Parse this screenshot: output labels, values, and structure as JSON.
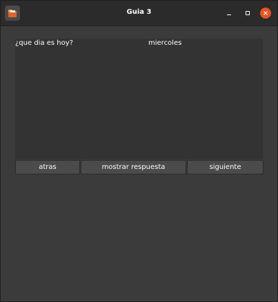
{
  "window": {
    "title": "Guia 3"
  },
  "titlebar": {
    "app_icon": "app-folder-icon",
    "controls": [
      "minimize-icon",
      "maximize-icon",
      "close-icon"
    ],
    "close_color": "#e95420"
  },
  "card": {
    "question": "¿que dia es hoy?",
    "answer": "miercoles"
  },
  "buttons": {
    "back": "atras",
    "show_answer": "mostrar respuesta",
    "next": "siguiente"
  }
}
